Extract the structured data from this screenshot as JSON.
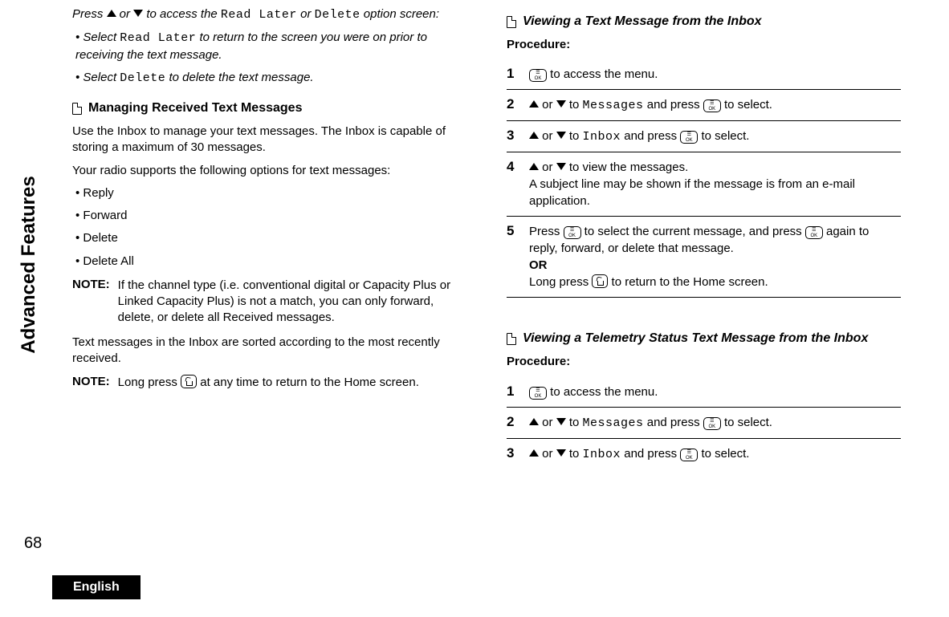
{
  "sideLabel": "Advanced Features",
  "pageNum": "68",
  "lang": "English",
  "left": {
    "intro1a": "Press ",
    "intro1b": " or ",
    "intro1c": " to access the ",
    "intro1_readlater": "Read Later",
    "intro1d": " or ",
    "intro1_delete": "Delete",
    "intro1e": " option screen:",
    "bullet1a": "Select ",
    "bullet1_rl": "Read Later",
    "bullet1b": " to return to the screen you were on prior to receiving the text message.",
    "bullet2a": "Select ",
    "bullet2_del": "Delete",
    "bullet2b": " to delete the text message.",
    "heading1": "Managing Received Text Messages",
    "para1": "Use the Inbox to manage your text messages. The Inbox is capable of storing a maximum of 30 messages.",
    "para2": "Your radio supports the following options for text messages:",
    "opts": [
      "Reply",
      "Forward",
      "Delete",
      "Delete All"
    ],
    "noteLabel": "NOTE:",
    "note1": "If the channel type (i.e. conventional digital or Capacity Plus or Linked Capacity Plus) is not a match, you can only forward, delete, or delete all Received messages.",
    "para3": "Text messages in the Inbox are sorted according to the most recently received.",
    "note2a": "Long press ",
    "note2b": " at any time to return to the Home screen."
  },
  "right": {
    "heading1": "Viewing a Text Message from the Inbox",
    "procLabel": "Procedure:",
    "s1a": " to access the menu.",
    "s2a": " or ",
    "s2b": " to ",
    "s2_msg": "Messages",
    "s2c": " and press ",
    "s2d": " to select.",
    "s3_inbox": "Inbox",
    "s4a": " or ",
    "s4b": " to view the messages.",
    "s4c": "A subject line may be shown if the message is from an e-mail application.",
    "s5a": "Press ",
    "s5b": " to select the current message, and press ",
    "s5c": " again to reply, forward, or delete that message.",
    "s5or": "OR",
    "s5d": "Long press ",
    "s5e": " to return to the Home screen.",
    "heading2": "Viewing a Telemetry Status Text Message from the Inbox"
  },
  "okBtn": "☰\nOK"
}
